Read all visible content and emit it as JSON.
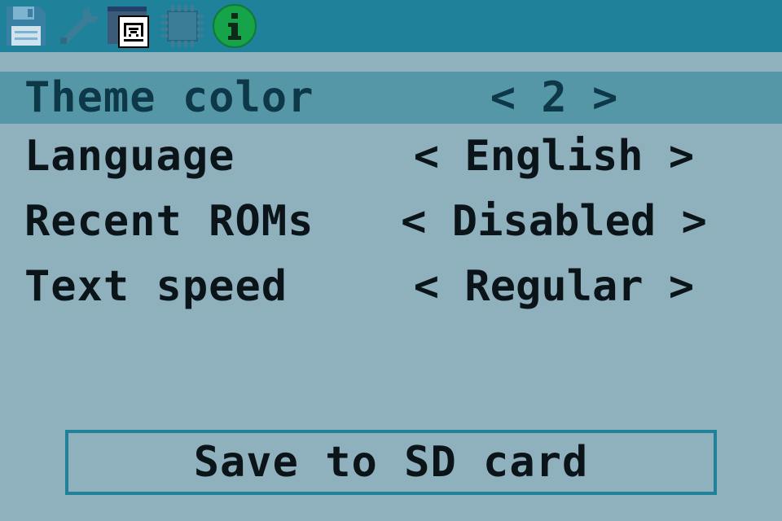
{
  "toolbar": {
    "icons": [
      {
        "name": "floppy-disk-icon",
        "selected": false
      },
      {
        "name": "wrench-icon",
        "selected": false
      },
      {
        "name": "palette-window-icon",
        "selected": true
      },
      {
        "name": "chip-icon",
        "selected": false
      },
      {
        "name": "info-icon",
        "selected": false
      }
    ]
  },
  "settings": {
    "rows": [
      {
        "label": "Theme color",
        "value": "2",
        "selected": true
      },
      {
        "label": "Language",
        "value": "English",
        "selected": false
      },
      {
        "label": "Recent ROMs",
        "value": "Disabled",
        "selected": false
      },
      {
        "label": "Text speed",
        "value": "Regular",
        "selected": false
      }
    ]
  },
  "save_button": {
    "label": "Save to SD card"
  },
  "colors": {
    "background": "#8fb1bd",
    "topbar": "#20829a",
    "selected_row": "#5597a6",
    "text": "#0b1418",
    "selected_text": "#0d3848"
  }
}
